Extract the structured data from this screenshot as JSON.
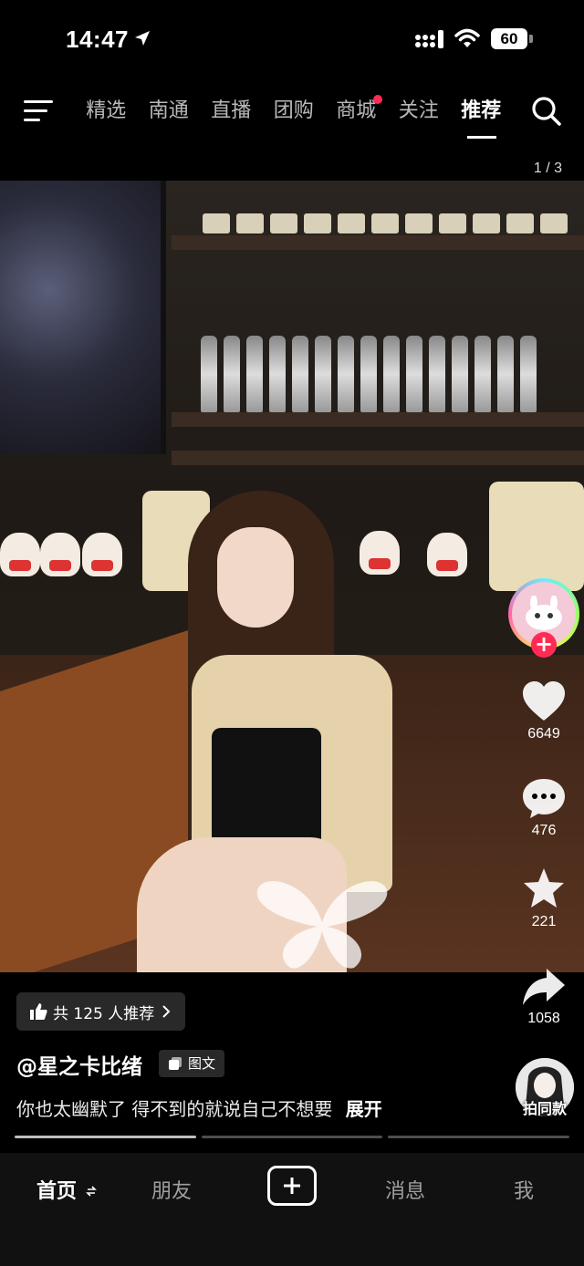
{
  "status_bar": {
    "time": "14:47",
    "battery": "60"
  },
  "top_nav": {
    "tabs": [
      {
        "label": "精选"
      },
      {
        "label": "南通"
      },
      {
        "label": "直播"
      },
      {
        "label": "团购"
      },
      {
        "label": "商城"
      },
      {
        "label": "关注"
      },
      {
        "label": "推荐"
      }
    ],
    "active_tab": "推荐",
    "dot_color": "#ff2b55"
  },
  "post": {
    "page_counter": "1 / 3",
    "recommend_pill": "共 125 人推荐",
    "author": "@星之卡比绪",
    "post_type": "图文",
    "caption": "你也太幽默了 得不到的就说自己不想要",
    "expand_label": "展开",
    "same_style_label": "拍同款"
  },
  "actions": {
    "likes": "6649",
    "comments": "476",
    "favorites": "221",
    "shares": "1058"
  },
  "bottom_nav": {
    "home": "首页",
    "friends": "朋友",
    "messages": "消息",
    "me": "我"
  }
}
